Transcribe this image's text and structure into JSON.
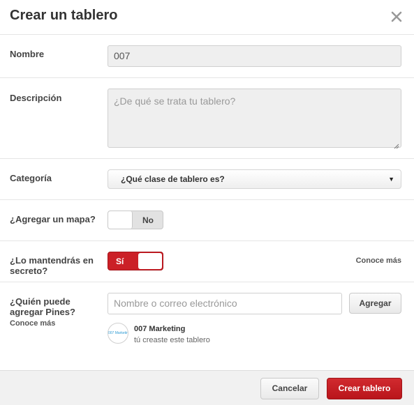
{
  "dialog": {
    "title": "Crear un tablero"
  },
  "fields": {
    "name": {
      "label": "Nombre",
      "value": "007"
    },
    "description": {
      "label": "Descripción",
      "placeholder": "¿De qué se trata tu tablero?"
    },
    "category": {
      "label": "Categoría",
      "selected": "¿Qué clase de tablero es?"
    },
    "map": {
      "label": "¿Agregar un mapa?",
      "state": "No"
    },
    "secret": {
      "label_line1": "¿Lo mantendrás en",
      "label_line2": "secreto?",
      "state": "Sí",
      "learn_more": "Conoce más"
    },
    "collaborators": {
      "label_line1": "¿Quién puede",
      "label_line2": "agregar Pines?",
      "learn_more": "Conoce más",
      "placeholder": "Nombre o correo electrónico",
      "add_label": "Agregar",
      "owner_name": "007 Marketing",
      "owner_note": "tú creaste este tablero",
      "avatar_text": "007 Marketing"
    }
  },
  "footer": {
    "cancel_label": "Cancelar",
    "create_label": "Crear tablero"
  },
  "colors": {
    "accent": "#cb2027",
    "divider": "#e5e5e5"
  }
}
